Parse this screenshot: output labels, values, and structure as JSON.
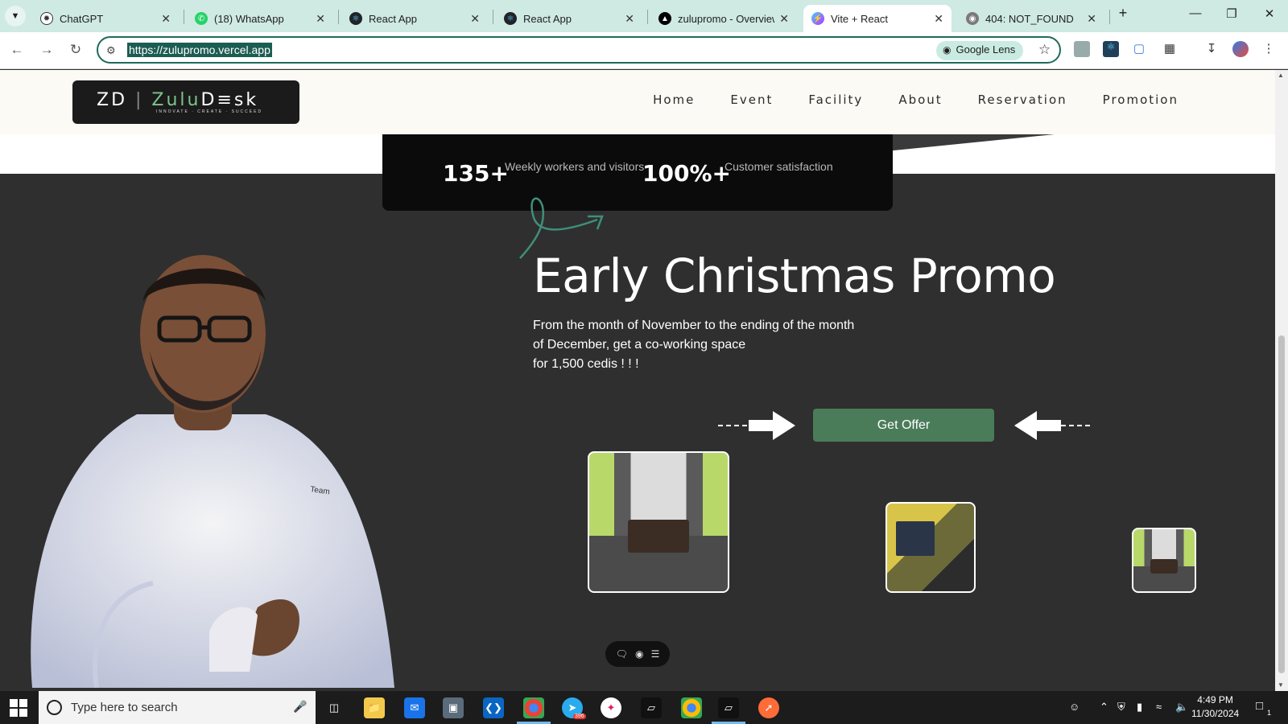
{
  "browser": {
    "tabs": [
      {
        "label": "ChatGPT",
        "icon": "chatgpt-icon",
        "active": false
      },
      {
        "label": "(18) WhatsApp",
        "icon": "whatsapp-icon",
        "active": false
      },
      {
        "label": "React App",
        "icon": "react-icon",
        "active": false
      },
      {
        "label": "React App",
        "icon": "react-icon",
        "active": false
      },
      {
        "label": "zulupromo - Overview",
        "icon": "vercel-icon",
        "active": false
      },
      {
        "label": "Vite + React",
        "icon": "vite-icon",
        "active": true
      },
      {
        "label": "404: NOT_FOUND",
        "icon": "globe-icon",
        "active": false
      }
    ],
    "new_tab": "+",
    "url": "https://zulupromo.vercel.app",
    "google_lens_label": "Google Lens"
  },
  "site": {
    "logo": {
      "prefix": "ZD",
      "name_a": "Zulu",
      "name_b": "D≡sk",
      "tagline": "INNOVATE · CREATE · SUCCEED"
    },
    "nav": [
      "Home",
      "Event",
      "Facility",
      "About",
      "Reservation",
      "Promotion"
    ],
    "stats": [
      {
        "value": "135+",
        "label": "Weekly workers and visitors"
      },
      {
        "value": "100%+",
        "label": "Customer satisfaction"
      }
    ],
    "promo": {
      "title": "Early Christmas Promo",
      "lines": [
        "From the month of November to the ending of the month",
        "of December, get a co-working space",
        "for 1,500 cedis ! ! !"
      ],
      "cta": "Get Offer"
    },
    "accent_color": "#4a7c59"
  },
  "taskbar": {
    "search_placeholder": "Type here to search",
    "time": "4:49 PM",
    "date": "11/30/2024",
    "telegram_badge": "396",
    "notification_count": "1"
  }
}
